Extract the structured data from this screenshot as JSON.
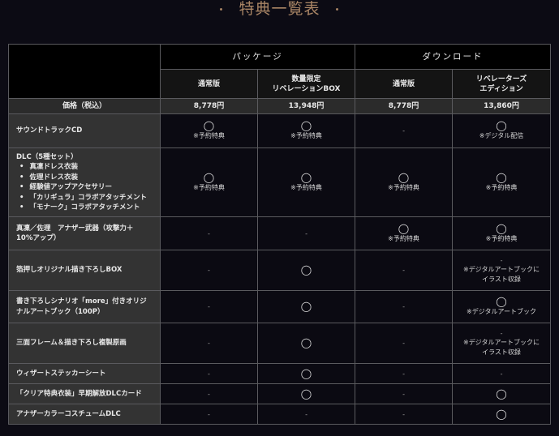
{
  "title": "特典一覧表",
  "title_dot": "・",
  "groups": [
    "パッケージ",
    "ダウンロード"
  ],
  "editions": [
    [
      "通常版"
    ],
    [
      "数量限定",
      "リベレーションBOX"
    ],
    [
      "通常版"
    ],
    [
      "リベレーターズ",
      "エディション"
    ]
  ],
  "price": {
    "label": "価格（税込）",
    "values": [
      "8,778円",
      "13,948円",
      "8,778円",
      "13,860円"
    ]
  },
  "mark_symbol": "◯",
  "dash_symbol": "-",
  "rows": [
    {
      "label": [
        "サウンドトラックCD"
      ],
      "cells": [
        {
          "mark": "◯",
          "note": [
            "※予約特典"
          ]
        },
        {
          "mark": "◯",
          "note": [
            "※予約特典"
          ]
        },
        {
          "dash": "-"
        },
        {
          "mark": "◯",
          "note": [
            "※デジタル配信"
          ]
        }
      ]
    },
    {
      "label": [
        "DLC（5種セット）"
      ],
      "bullets": [
        "真凜ドレス衣装",
        "佐理ドレス衣装",
        "経験値アップアクセサリー",
        "「カリギュラ」コラボアタッチメント",
        "「モナーク」コラボアタッチメント"
      ],
      "cells": [
        {
          "mark": "◯",
          "note": [
            "※予約特典"
          ]
        },
        {
          "mark": "◯",
          "note": [
            "※予約特典"
          ]
        },
        {
          "mark": "◯",
          "note": [
            "※予約特典"
          ]
        },
        {
          "mark": "◯",
          "note": [
            "※予約特典"
          ]
        }
      ]
    },
    {
      "label": [
        "真凜／佐理　アナザー武器（攻撃力＋",
        "10%アップ）"
      ],
      "cells": [
        {
          "dash": "-"
        },
        {
          "dash": "-"
        },
        {
          "mark": "◯",
          "note": [
            "※予約特典"
          ]
        },
        {
          "mark": "◯",
          "note": [
            "※予約特典"
          ]
        }
      ]
    },
    {
      "label": [
        "箔押しオリジナル描き下ろしBOX"
      ],
      "cells": [
        {
          "dash": "-"
        },
        {
          "mark": "◯"
        },
        {
          "dash": "-"
        },
        {
          "dash": "-",
          "note": [
            "※デジタルアートブックに",
            "イラスト収録"
          ]
        }
      ]
    },
    {
      "label": [
        "書き下ろしシナリオ「more」付きオリジ",
        "ナルアートブック（100P）"
      ],
      "cells": [
        {
          "dash": "-"
        },
        {
          "mark": "◯"
        },
        {
          "dash": "-"
        },
        {
          "mark": "◯",
          "note": [
            "※デジタルアートブック"
          ]
        }
      ]
    },
    {
      "label": [
        "三面フレーム＆描き下ろし複製原画"
      ],
      "cells": [
        {
          "dash": "-"
        },
        {
          "mark": "◯"
        },
        {
          "dash": "-"
        },
        {
          "dash": "-",
          "note": [
            "※デジタルアートブックに",
            "イラスト収録"
          ]
        }
      ]
    },
    {
      "label": [
        "ウィザートステッカーシート"
      ],
      "cells": [
        {
          "dash": "-"
        },
        {
          "mark": "◯"
        },
        {
          "dash": "-"
        },
        {
          "dash": "-"
        }
      ]
    },
    {
      "label": [
        "「クリア特典衣装」早期解放DLCカード"
      ],
      "cells": [
        {
          "dash": "-"
        },
        {
          "mark": "◯"
        },
        {
          "dash": "-"
        },
        {
          "mark": "◯"
        }
      ]
    },
    {
      "label": [
        "アナザーカラーコスチュームDLC"
      ],
      "cells": [
        {
          "dash": "-"
        },
        {
          "dash": "-"
        },
        {
          "dash": "-"
        },
        {
          "mark": "◯"
        }
      ]
    }
  ]
}
